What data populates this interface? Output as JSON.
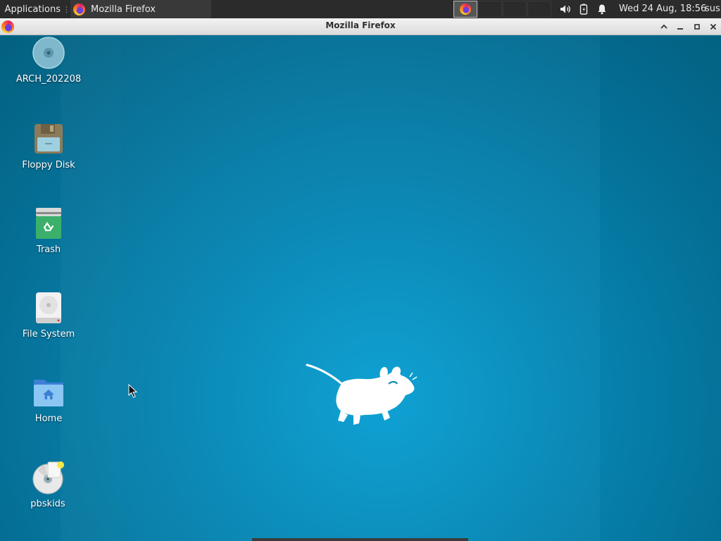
{
  "panel": {
    "applications_label": "Applications",
    "task_label": "Mozilla Firefox",
    "clock": "Wed 24 Aug, 18:56",
    "user": "sus",
    "tray_icons": [
      "volume-icon",
      "battery-icon",
      "notification-bell-icon"
    ]
  },
  "window": {
    "title": "Mozilla Firefox",
    "buttons": [
      "chevron-up-icon",
      "minimize-icon",
      "maximize-icon",
      "close-icon"
    ]
  },
  "desktop": {
    "icons": [
      {
        "name": "cd-rom",
        "label": "ARCH_202208",
        "icon": "optical-disc-icon"
      },
      {
        "name": "floppy-disk",
        "label": "Floppy Disk",
        "icon": "floppy-disk-icon"
      },
      {
        "name": "trash",
        "label": "Trash",
        "icon": "trash-icon"
      },
      {
        "name": "file-system",
        "label": "File System",
        "icon": "hard-drive-icon"
      },
      {
        "name": "home",
        "label": "Home",
        "icon": "home-folder-icon"
      },
      {
        "name": "pbskids",
        "label": "pbskids",
        "icon": "disc-file-icon"
      }
    ],
    "wallpaper_icon": "xfce-mouse-icon"
  },
  "colors": {
    "panel_bg": "#2b2b2b",
    "desktop_bg": "#0788b6",
    "titlebar_bg": "#e6e6e6"
  }
}
